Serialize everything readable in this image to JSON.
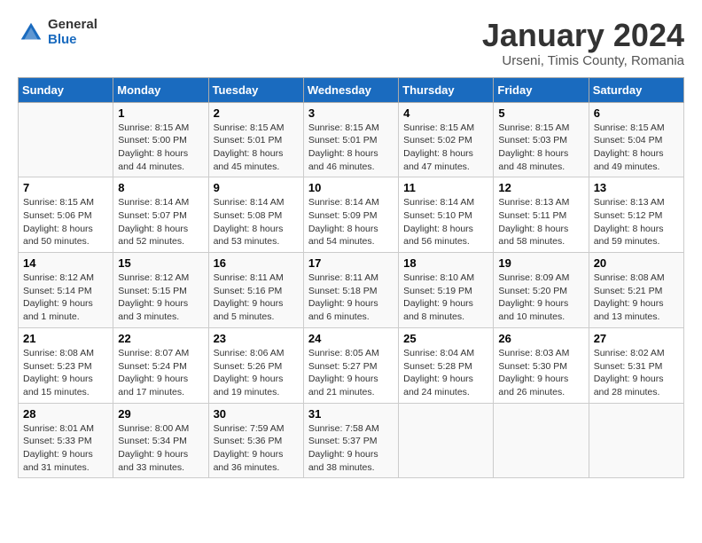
{
  "logo": {
    "general": "General",
    "blue": "Blue"
  },
  "title": "January 2024",
  "subtitle": "Urseni, Timis County, Romania",
  "days_header": [
    "Sunday",
    "Monday",
    "Tuesday",
    "Wednesday",
    "Thursday",
    "Friday",
    "Saturday"
  ],
  "weeks": [
    [
      {
        "day": "",
        "info": ""
      },
      {
        "day": "1",
        "info": "Sunrise: 8:15 AM\nSunset: 5:00 PM\nDaylight: 8 hours\nand 44 minutes."
      },
      {
        "day": "2",
        "info": "Sunrise: 8:15 AM\nSunset: 5:01 PM\nDaylight: 8 hours\nand 45 minutes."
      },
      {
        "day": "3",
        "info": "Sunrise: 8:15 AM\nSunset: 5:01 PM\nDaylight: 8 hours\nand 46 minutes."
      },
      {
        "day": "4",
        "info": "Sunrise: 8:15 AM\nSunset: 5:02 PM\nDaylight: 8 hours\nand 47 minutes."
      },
      {
        "day": "5",
        "info": "Sunrise: 8:15 AM\nSunset: 5:03 PM\nDaylight: 8 hours\nand 48 minutes."
      },
      {
        "day": "6",
        "info": "Sunrise: 8:15 AM\nSunset: 5:04 PM\nDaylight: 8 hours\nand 49 minutes."
      }
    ],
    [
      {
        "day": "7",
        "info": "Sunrise: 8:15 AM\nSunset: 5:06 PM\nDaylight: 8 hours\nand 50 minutes."
      },
      {
        "day": "8",
        "info": "Sunrise: 8:14 AM\nSunset: 5:07 PM\nDaylight: 8 hours\nand 52 minutes."
      },
      {
        "day": "9",
        "info": "Sunrise: 8:14 AM\nSunset: 5:08 PM\nDaylight: 8 hours\nand 53 minutes."
      },
      {
        "day": "10",
        "info": "Sunrise: 8:14 AM\nSunset: 5:09 PM\nDaylight: 8 hours\nand 54 minutes."
      },
      {
        "day": "11",
        "info": "Sunrise: 8:14 AM\nSunset: 5:10 PM\nDaylight: 8 hours\nand 56 minutes."
      },
      {
        "day": "12",
        "info": "Sunrise: 8:13 AM\nSunset: 5:11 PM\nDaylight: 8 hours\nand 58 minutes."
      },
      {
        "day": "13",
        "info": "Sunrise: 8:13 AM\nSunset: 5:12 PM\nDaylight: 8 hours\nand 59 minutes."
      }
    ],
    [
      {
        "day": "14",
        "info": "Sunrise: 8:12 AM\nSunset: 5:14 PM\nDaylight: 9 hours\nand 1 minute."
      },
      {
        "day": "15",
        "info": "Sunrise: 8:12 AM\nSunset: 5:15 PM\nDaylight: 9 hours\nand 3 minutes."
      },
      {
        "day": "16",
        "info": "Sunrise: 8:11 AM\nSunset: 5:16 PM\nDaylight: 9 hours\nand 5 minutes."
      },
      {
        "day": "17",
        "info": "Sunrise: 8:11 AM\nSunset: 5:18 PM\nDaylight: 9 hours\nand 6 minutes."
      },
      {
        "day": "18",
        "info": "Sunrise: 8:10 AM\nSunset: 5:19 PM\nDaylight: 9 hours\nand 8 minutes."
      },
      {
        "day": "19",
        "info": "Sunrise: 8:09 AM\nSunset: 5:20 PM\nDaylight: 9 hours\nand 10 minutes."
      },
      {
        "day": "20",
        "info": "Sunrise: 8:08 AM\nSunset: 5:21 PM\nDaylight: 9 hours\nand 13 minutes."
      }
    ],
    [
      {
        "day": "21",
        "info": "Sunrise: 8:08 AM\nSunset: 5:23 PM\nDaylight: 9 hours\nand 15 minutes."
      },
      {
        "day": "22",
        "info": "Sunrise: 8:07 AM\nSunset: 5:24 PM\nDaylight: 9 hours\nand 17 minutes."
      },
      {
        "day": "23",
        "info": "Sunrise: 8:06 AM\nSunset: 5:26 PM\nDaylight: 9 hours\nand 19 minutes."
      },
      {
        "day": "24",
        "info": "Sunrise: 8:05 AM\nSunset: 5:27 PM\nDaylight: 9 hours\nand 21 minutes."
      },
      {
        "day": "25",
        "info": "Sunrise: 8:04 AM\nSunset: 5:28 PM\nDaylight: 9 hours\nand 24 minutes."
      },
      {
        "day": "26",
        "info": "Sunrise: 8:03 AM\nSunset: 5:30 PM\nDaylight: 9 hours\nand 26 minutes."
      },
      {
        "day": "27",
        "info": "Sunrise: 8:02 AM\nSunset: 5:31 PM\nDaylight: 9 hours\nand 28 minutes."
      }
    ],
    [
      {
        "day": "28",
        "info": "Sunrise: 8:01 AM\nSunset: 5:33 PM\nDaylight: 9 hours\nand 31 minutes."
      },
      {
        "day": "29",
        "info": "Sunrise: 8:00 AM\nSunset: 5:34 PM\nDaylight: 9 hours\nand 33 minutes."
      },
      {
        "day": "30",
        "info": "Sunrise: 7:59 AM\nSunset: 5:36 PM\nDaylight: 9 hours\nand 36 minutes."
      },
      {
        "day": "31",
        "info": "Sunrise: 7:58 AM\nSunset: 5:37 PM\nDaylight: 9 hours\nand 38 minutes."
      },
      {
        "day": "",
        "info": ""
      },
      {
        "day": "",
        "info": ""
      },
      {
        "day": "",
        "info": ""
      }
    ]
  ]
}
